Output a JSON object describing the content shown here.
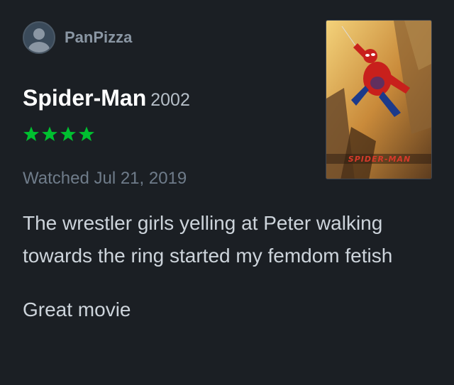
{
  "user": {
    "name": "PanPizza",
    "avatar_icon": "default-user-icon"
  },
  "film": {
    "title": "Spider-Man",
    "year": "2002",
    "poster_text": "SPIDER-MAN"
  },
  "rating": {
    "stars": 4,
    "max": 5,
    "color": "#00c030"
  },
  "watched": "Watched Jul 21, 2019",
  "review": {
    "paragraphs": [
      "The wrestler girls yelling at Peter walking towards the ring started my femdom fetish",
      "Great movie"
    ]
  }
}
